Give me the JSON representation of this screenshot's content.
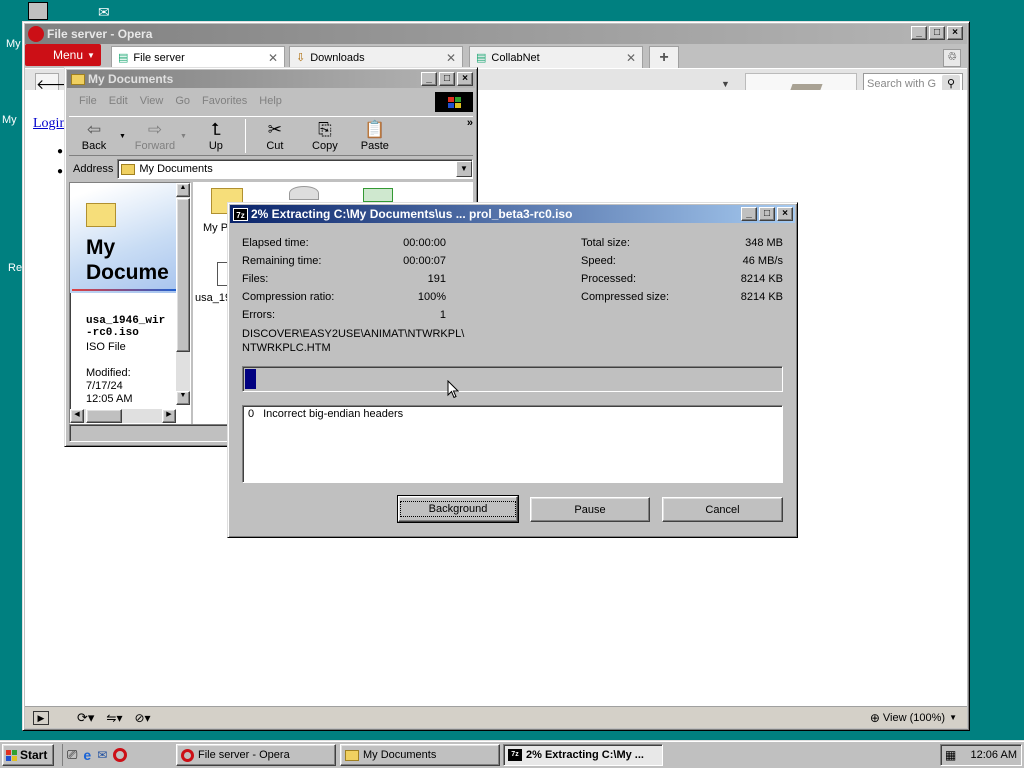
{
  "desktop": {
    "labels": [
      "My",
      "My",
      "Re"
    ]
  },
  "opera": {
    "title": "File server - Opera",
    "menu_label": "Menu",
    "tabs": [
      {
        "label": "File server"
      },
      {
        "label": "Downloads"
      },
      {
        "label": "CollabNet"
      }
    ],
    "search_placeholder": "Search with G",
    "page_link": "Login",
    "zoom_label": "View (100%)"
  },
  "mydocs": {
    "title": "My Documents",
    "menu": [
      "File",
      "Edit",
      "View",
      "Go",
      "Favorites",
      "Help"
    ],
    "toolbar": {
      "back": "Back",
      "forward": "Forward",
      "up": "Up",
      "cut": "Cut",
      "copy": "Copy",
      "paste": "Paste"
    },
    "address_label": "Address",
    "address_value": "My Documents",
    "panel_title": "My Docume",
    "selected_name": "usa_1946_wir\n-rc0.iso",
    "selected_type": "ISO File",
    "modified_label": "Modified:",
    "modified_date": "7/17/24",
    "modified_time": "12:05 AM",
    "file_labels": [
      "My P",
      "usa_19"
    ]
  },
  "sevenz": {
    "title": "2% Extracting C:\\My Documents\\us ... prol_beta3-rc0.iso",
    "left_stats": [
      {
        "label": "Elapsed time:",
        "value": "00:00:00"
      },
      {
        "label": "Remaining time:",
        "value": "00:00:07"
      },
      {
        "label": "Files:",
        "value": "191"
      },
      {
        "label": "Compression ratio:",
        "value": "100%"
      },
      {
        "label": "Errors:",
        "value": "1"
      }
    ],
    "right_stats": [
      {
        "label": "Total size:",
        "value": "348 MB"
      },
      {
        "label": "Speed:",
        "value": "46 MB/s"
      },
      {
        "label": "Processed:",
        "value": "8214 KB"
      },
      {
        "label": "Compressed size:",
        "value": "8214 KB"
      }
    ],
    "current_path_1": "DISCOVER\\EASY2USE\\ANIMAT\\NTWRKPL\\",
    "current_path_2": "NTWRKPLC.HTM",
    "progress_percent": 2,
    "log_index": "0",
    "log_message": "Incorrect big-endian headers",
    "buttons": {
      "background": "Background",
      "pause": "Pause",
      "cancel": "Cancel"
    }
  },
  "taskbar": {
    "start": "Start",
    "tasks": [
      {
        "label": "File server - Opera"
      },
      {
        "label": "My Documents"
      },
      {
        "label": "2% Extracting C:\\My ..."
      }
    ],
    "clock": "12:06 AM"
  }
}
